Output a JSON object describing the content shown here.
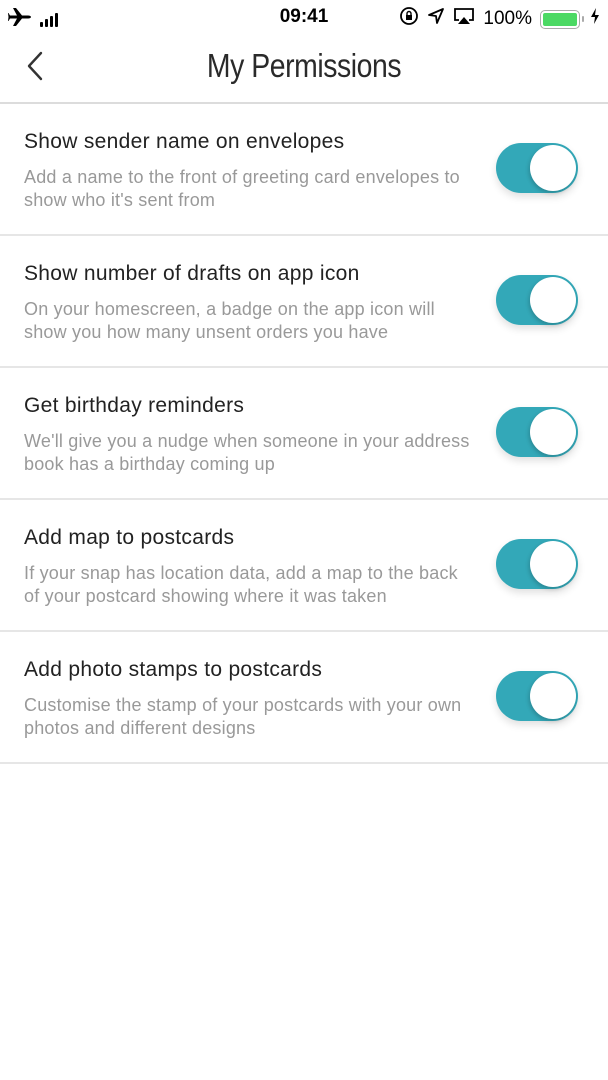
{
  "status_bar": {
    "time": "09:41",
    "battery_percent": "100%",
    "battery_level": 1.0,
    "icons": [
      "airplane-icon",
      "signal-icon",
      "orientation-lock-icon",
      "location-icon",
      "airplay-icon",
      "battery-icon",
      "charging-icon"
    ]
  },
  "header": {
    "title": "My Permissions",
    "back_icon": "chevron-left-icon"
  },
  "colors": {
    "toggle_on": "#33a8b8",
    "battery": "#4cd964"
  },
  "permissions": [
    {
      "title": "Show sender name on envelopes",
      "description": "Add a name to the front of greeting card envelopes to show who it's sent from",
      "enabled": true
    },
    {
      "title": "Show number of drafts on app icon",
      "description": "On your homescreen, a badge on the app icon will show you how many unsent orders you have",
      "enabled": true
    },
    {
      "title": "Get birthday reminders",
      "description": "We'll give you a nudge when someone in your address book has a birthday coming up",
      "enabled": true
    },
    {
      "title": "Add map to postcards",
      "description": "If your snap has location data, add a map to the back of your postcard showing where it was taken",
      "enabled": true
    },
    {
      "title": "Add photo stamps to postcards",
      "description": "Customise the stamp of your postcards with your own photos and different designs",
      "enabled": true
    }
  ]
}
